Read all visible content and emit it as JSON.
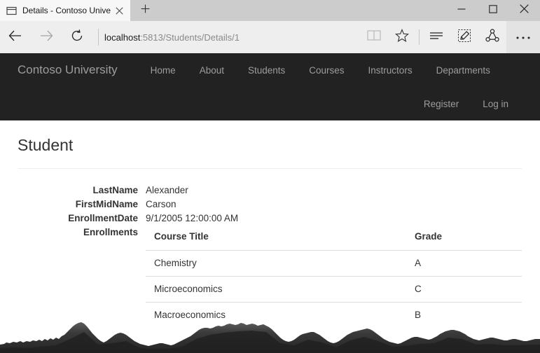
{
  "browser": {
    "tab": {
      "title": "Details - Contoso Unive",
      "favicon_icon": "page-outline-icon",
      "close_icon": "close-icon"
    },
    "new_tab_icon": "plus-icon",
    "window_controls": {
      "minimize_icon": "minimize-icon",
      "maximize_icon": "maximize-icon",
      "close_icon": "window-close-icon"
    },
    "toolbar": {
      "back_icon": "back-arrow-icon",
      "forward_icon": "forward-arrow-icon",
      "refresh_icon": "refresh-icon",
      "address": {
        "host": "localhost",
        "path": ":5813/Students/Details/1",
        "full": "localhost:5813/Students/Details/1"
      },
      "reading_view_icon": "book-icon",
      "favorites_icon": "star-icon",
      "hub_icon": "hub-lines-icon",
      "web_note_icon": "pencil-note-icon",
      "share_icon": "share-icon",
      "more_icon": "ellipsis-icon"
    }
  },
  "site": {
    "brand": "Contoso University",
    "nav_links": [
      {
        "label": "Home"
      },
      {
        "label": "About"
      },
      {
        "label": "Students"
      },
      {
        "label": "Courses"
      },
      {
        "label": "Instructors"
      },
      {
        "label": "Departments"
      }
    ],
    "auth_links": [
      {
        "label": "Register"
      },
      {
        "label": "Log in"
      }
    ],
    "colors": {
      "navbar_bg": "#222222",
      "nav_link": "#9d9d9d",
      "body_text": "#333333",
      "rule": "#dddddd"
    }
  },
  "main": {
    "page_title": "Student",
    "details": [
      {
        "label": "LastName",
        "value": "Alexander"
      },
      {
        "label": "FirstMidName",
        "value": "Carson"
      },
      {
        "label": "EnrollmentDate",
        "value": "9/1/2005 12:00:00 AM"
      }
    ],
    "enrollments_label": "Enrollments",
    "enrollments_table": {
      "columns": [
        "Course Title",
        "Grade"
      ],
      "rows": [
        {
          "course": "Chemistry",
          "grade": "A"
        },
        {
          "course": "Microeconomics",
          "grade": "C"
        },
        {
          "course": "Macroeconomics",
          "grade": "B"
        }
      ]
    }
  }
}
